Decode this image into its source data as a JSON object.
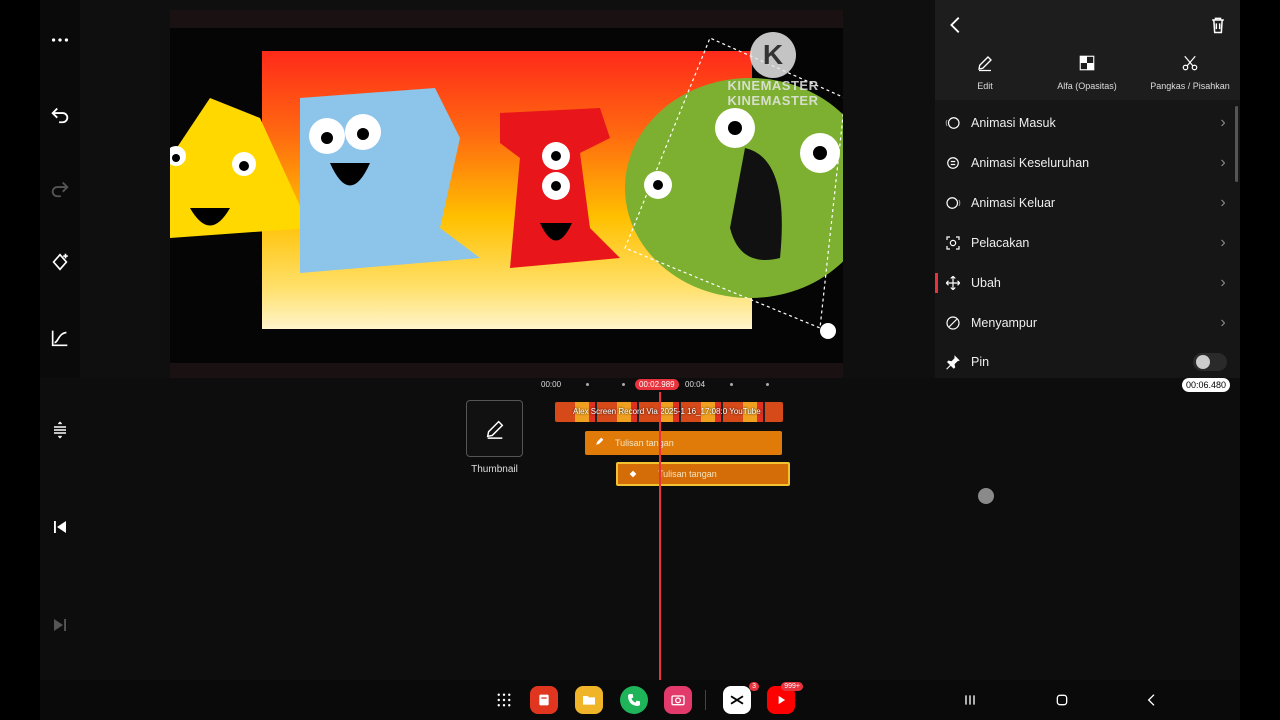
{
  "preview": {
    "watermark_letter": "K",
    "watermark_text": "KINEMASTER",
    "watermark_text_2": "KINEMASTER"
  },
  "panel": {
    "header_buttons": [
      {
        "label": "Edit",
        "icon": "pencil-icon"
      },
      {
        "label": "Alfa (Opasitas)",
        "icon": "checkerboard-icon"
      },
      {
        "label": "Pangkas / Pisahkan",
        "icon": "scissors-icon"
      }
    ],
    "items": [
      {
        "label": "Animasi Masuk",
        "icon": "animation-in-icon"
      },
      {
        "label": "Animasi Keseluruhan",
        "icon": "animation-overall-icon"
      },
      {
        "label": "Animasi Keluar",
        "icon": "animation-out-icon"
      },
      {
        "label": "Pelacakan",
        "icon": "tracking-icon"
      },
      {
        "label": "Ubah",
        "icon": "transform-icon",
        "active": true
      },
      {
        "label": "Menyampur",
        "icon": "blend-icon"
      },
      {
        "label": "Pin",
        "icon": "pin-icon",
        "toggle": false
      }
    ]
  },
  "timeline": {
    "ruler": [
      "00:00",
      "00:04"
    ],
    "playhead_time": "00:02.989",
    "total_time": "00:06.480",
    "thumbnail_label": "Thumbnail",
    "video_clip_label": "Alex Screen Record Via 2025-1 16_17:08:0 YouTube",
    "handwriting_1": "Tulisan tangan",
    "handwriting_2": "Tulisan tangan"
  },
  "nav": {
    "badges": {
      "capcut": "3",
      "youtube": "999+"
    }
  },
  "colors": {
    "accent": "#e8323c",
    "handwriting_clip": "#e07b0a",
    "selected_border": "#f2c230"
  }
}
